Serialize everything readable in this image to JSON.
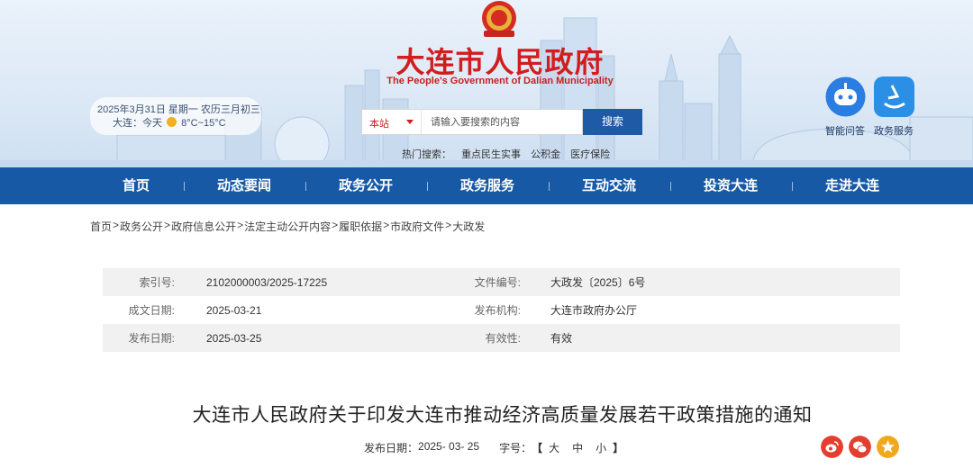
{
  "header": {
    "title": "大连市人民政府",
    "subtitle": "The People's Government of Dalian Municipality",
    "date_line": "2025年3月31日 星期一 农历三月初三",
    "weather_city": "大连：今天",
    "weather_temp": "8°C~15°C"
  },
  "search": {
    "scope": "本站",
    "placeholder": "请输入要搜索的内容",
    "button": "搜索",
    "hot_label": "热门搜索：",
    "hot_items": [
      "重点民生实事",
      "公积金",
      "医疗保险"
    ]
  },
  "apps": [
    {
      "label": "智能问答",
      "icon": "robot-icon",
      "color": "#2a7de1"
    },
    {
      "label": "政务服务",
      "icon": "service-icon",
      "color": "#2b8fe6"
    }
  ],
  "nav": [
    "首页",
    "动态要闻",
    "政务公开",
    "政务服务",
    "互动交流",
    "投资大连",
    "走进大连"
  ],
  "breadcrumb": [
    "首页",
    "政务公开",
    "政府信息公开",
    "法定主动公开内容",
    "履职依据",
    "市政府文件",
    "大政发"
  ],
  "breadcrumb_sep": ">",
  "info": {
    "index_label": "索引号:",
    "index_value": "2102000003/2025-17225",
    "docno_label": "文件编号:",
    "docno_value": "大政发〔2025〕6号",
    "written_label": "成文日期:",
    "written_value": "2025-03-21",
    "issuer_label": "发布机构:",
    "issuer_value": "大连市政府办公厅",
    "pub_label": "发布日期:",
    "pub_value": "2025-03-25",
    "valid_label": "有效性:",
    "valid_value": "有效"
  },
  "article": {
    "title": "大连市人民政府关于印发大连市推动经济高质量发展若干政策措施的通知",
    "pub_label": "发布日期：",
    "pub_date": "2025- 03- 25",
    "font_label": "字号：",
    "bracket_open": "【",
    "bracket_close": "】",
    "font_sizes": [
      "大",
      "中",
      "小"
    ]
  },
  "share": [
    {
      "icon": "weibo-icon",
      "color": "#e53d2f"
    },
    {
      "icon": "wechat-icon",
      "color": "#e53d2f"
    },
    {
      "icon": "favorite-icon",
      "color": "#f0a81e"
    }
  ],
  "colors": {
    "brand_red": "#d21d1d",
    "nav_blue": "#1859a5",
    "search_blue": "#1f5aa6"
  }
}
